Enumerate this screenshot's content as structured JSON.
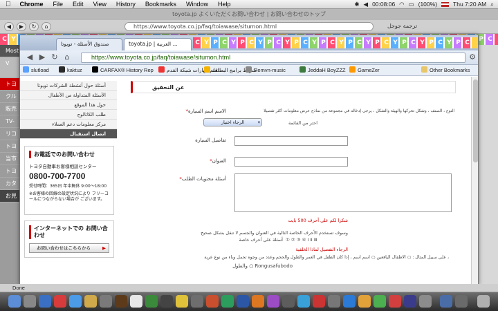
{
  "menubar": {
    "apple": "",
    "app_name": "Chrome",
    "items": [
      "File",
      "Edit",
      "View",
      "History",
      "Bookmarks",
      "Window",
      "Help"
    ],
    "time_left": "00:08:06",
    "battery": "(100%)",
    "clock": "Thu 7:20 AM"
  },
  "back_window": {
    "title": "toyota.jp よくいただくお問い合わせ | お問い合わせのトップ",
    "url": "https://www.toyota.co.jp/faq/toiawase/situmon.html",
    "url_small": "ترجمة جوجل",
    "left_labels": [
      "Most V",
      "トヨ",
      "クル",
      "販売",
      "TV-",
      "リコ",
      "トヨ",
      "当市",
      "トヨ",
      "カタ",
      "お見"
    ]
  },
  "front_window": {
    "tabs": [
      "صندوق الأسئلة - تويوتا",
      "toyota.jp | العربية ..."
    ],
    "url": "https://www.toyota.co.jp/faq/toiawase/situmon.html",
    "bookmarks": [
      "slutload",
      "kaktuz",
      "CARFAX® History Rep",
      "تعلم مهارات شبكة القدم",
      "شريط برامج البطاقة",
      "Remvn-music",
      "JeddaH BoyZZZ",
      "GameZer",
      "Other Bookmarks"
    ]
  },
  "page": {
    "left_links": [
      "أسئلة حول أنشطة الشركات تويوتا",
      "الأسئلة المتداولة من الأطفال",
      "حول هذا الموقع",
      "طلب الكاتالوج",
      "مركز معلومات دعم العملاء"
    ],
    "left_active": "اتصال استقبال",
    "phone_box": {
      "title": "お電話でのお問い合わせ",
      "subtitle": "トヨタ自動車お客様相談センター",
      "number": "0800-700-7700",
      "hours": "受付時間：365日 年中無休 9:00～18:00",
      "note": "※お客様の回線の設定状況により フリーコールにつながらない場合が ございます。"
    },
    "net_box": {
      "title": "インターネットでの お問い合わせ",
      "button": "お問い合わせはこちらから"
    },
    "section_title": "عن التحقيق",
    "car_name_label": "الاسم اسم السيارة",
    "car_name_note": "النوع ، الصنف ، وشكل تحركها والهيئة والشكل ، يرجى إدخاله في مجموعة من نماذج عرض معلومات أكثر تفصيلا",
    "car_select_value": "الرجاء اختيار",
    "car_select_hint": "اختر من القائمة",
    "car_details_label": "تفاصيل السيارة",
    "address_label": "العنوان",
    "question_label": "أسئلة محتويات الطلب",
    "chars_note": "شكرا لكم على أحرف 500 بايت",
    "line_1": "وسوف تستخدم الأحرف الخاصة التالية في العنوان والجسم لا تنقل بشكل صحيح",
    "line_2": "أسئلة على أحرف خاصة",
    "circled": "① ② ③ ④ Ⅰ Ⅱ Ⅲ",
    "line_3": "الرجاء التفصيل لماذا الخلفية",
    "line_4": "على سبيل المثال : ○ الأطفال اليافعين ○ اسم اسم ، إذا كان الطفل في العمر والطول والحجم وعدد من وجوه تحمل وباء من نوع عرية ،",
    "line_5": "والطول ○ Rongusafubodo"
  },
  "status": {
    "text": "Done"
  }
}
